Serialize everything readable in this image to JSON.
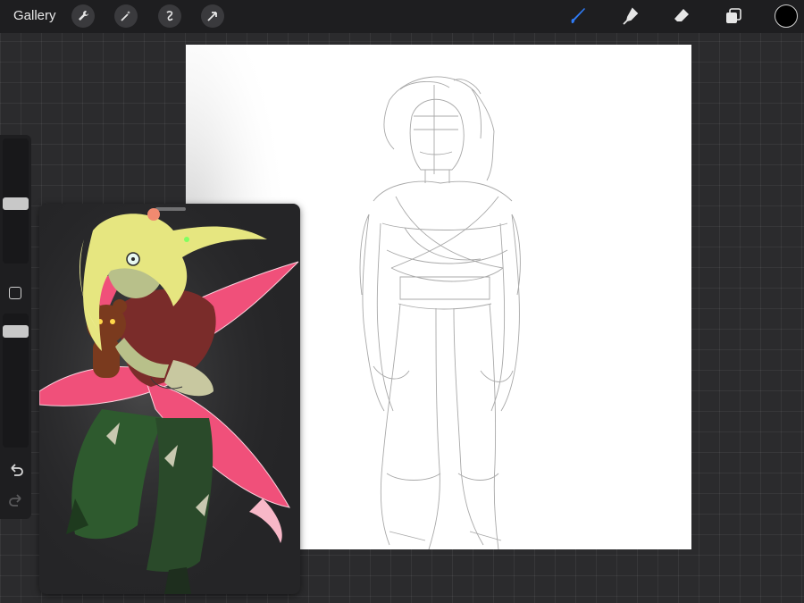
{
  "topbar": {
    "gallery_label": "Gallery",
    "left_tools": [
      "wrench-icon",
      "magic-wand-icon",
      "selection-icon",
      "transform-arrow-icon"
    ],
    "right_tools": [
      "brush-icon",
      "smudge-icon",
      "eraser-icon",
      "layers-icon"
    ],
    "active_tool": "brush-icon",
    "active_color": "#000000",
    "accent": "#2f7bf5"
  },
  "sidebar": {
    "controls": [
      "brush-size-slider",
      "modify-button",
      "opacity-slider",
      "undo-icon",
      "redo-icon"
    ]
  },
  "reference": {
    "window": "reference-image-window"
  }
}
